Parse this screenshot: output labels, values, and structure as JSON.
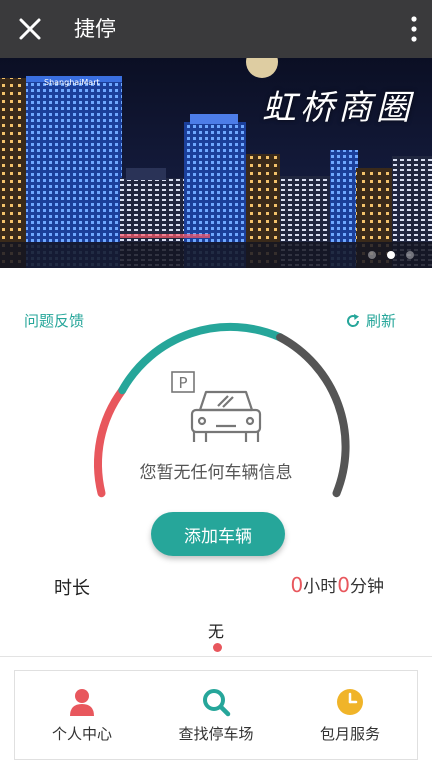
{
  "topbar": {
    "title": "捷停"
  },
  "banner": {
    "caption": "虹桥商圈",
    "sign_text": "ShanghaiMart",
    "slide_count": 3,
    "active_slide": 2
  },
  "actions": {
    "feedback_label": "问题反馈",
    "refresh_label": "刷新"
  },
  "vehicle": {
    "parking_letter": "P",
    "empty_message": "您暂无任何车辆信息",
    "add_button_label": "添加车辆"
  },
  "duration": {
    "label": "时长",
    "hours": "0",
    "hours_unit": "小时",
    "minutes": "0",
    "minutes_unit": "分钟"
  },
  "status": {
    "none_label": "无"
  },
  "nav": {
    "items": [
      {
        "label": "个人中心",
        "icon": "person-icon"
      },
      {
        "label": "查找停车场",
        "icon": "search-icon"
      },
      {
        "label": "包月服务",
        "icon": "clock-icon"
      }
    ]
  },
  "colors": {
    "accent": "#26a69a",
    "alert": "#e8575d",
    "gauge_gray": "#555555",
    "topbar": "#3a3a3c"
  }
}
